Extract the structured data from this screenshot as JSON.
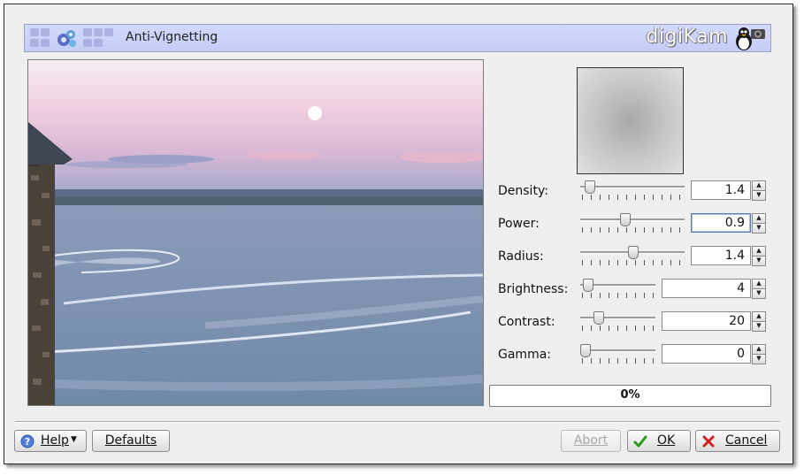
{
  "header": {
    "title": "Anti-Vignetting",
    "brand": "digiKam"
  },
  "preview": {
    "icon": "photo-preview"
  },
  "settings": {
    "density": {
      "label": "Density:",
      "value": "1.4",
      "level": 0.05
    },
    "power": {
      "label": "Power:",
      "value": "0.9",
      "level": 0.42
    },
    "radius": {
      "label": "Radius:",
      "value": "1.4",
      "level": 0.51
    },
    "brightness": {
      "label": "Brightness:",
      "value": "4",
      "level": 0.04
    },
    "contrast": {
      "label": "Contrast:",
      "value": "20",
      "level": 0.2
    },
    "gamma": {
      "label": "Gamma:",
      "value": "0",
      "level": 0.0
    }
  },
  "progress": {
    "text": "0%",
    "value": 0
  },
  "buttons": {
    "help": "Help",
    "defaults": "Defaults",
    "abort": "Abort",
    "ok": "OK",
    "cancel": "Cancel"
  },
  "colors": {
    "header_bg": "#c9cff7",
    "accent": "#5a78b8",
    "dialog_bg": "#efefef"
  }
}
